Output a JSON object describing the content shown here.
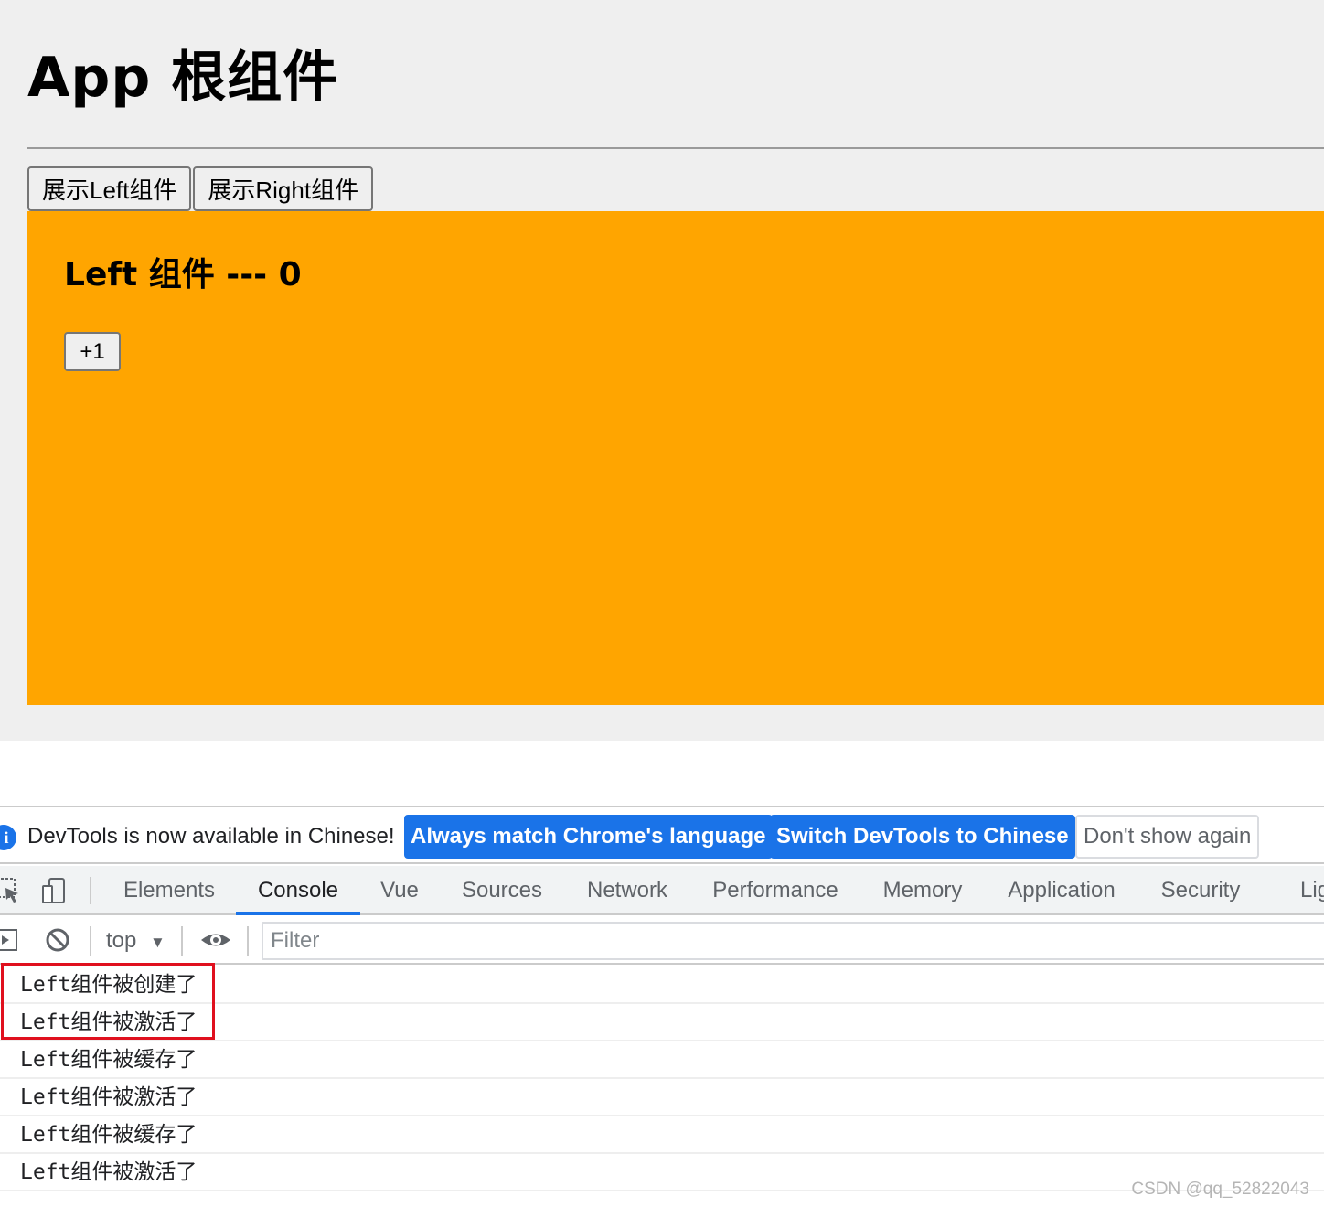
{
  "app": {
    "title": "App 根组件",
    "buttons": {
      "show_left": "展示Left组件",
      "show_right": "展示Right组件"
    },
    "left_component": {
      "title": "Left 组件 --- 0",
      "increment_label": "+1",
      "background": "#ffa500"
    }
  },
  "devtools": {
    "infobar": {
      "icon": "info-icon",
      "message": "DevTools is now available in Chinese!",
      "always_match": "Always match Chrome's language",
      "switch_chinese": "Switch DevTools to Chinese",
      "dont_show": "Don't show again"
    },
    "tabs": [
      "Elements",
      "Console",
      "Vue",
      "Sources",
      "Network",
      "Performance",
      "Memory",
      "Application",
      "Security",
      "Lig"
    ],
    "active_tab": "Console",
    "toolbar": {
      "context": "top",
      "filter_placeholder": "Filter"
    },
    "console_messages": [
      "Left组件被创建了",
      "Left组件被激活了",
      "Left组件被缓存了",
      "Left组件被激活了",
      "Left组件被缓存了",
      "Left组件被激活了"
    ],
    "accent_color": "#1a73e8",
    "highlight_color": "#e0101e"
  },
  "watermark": "CSDN @qq_52822043"
}
